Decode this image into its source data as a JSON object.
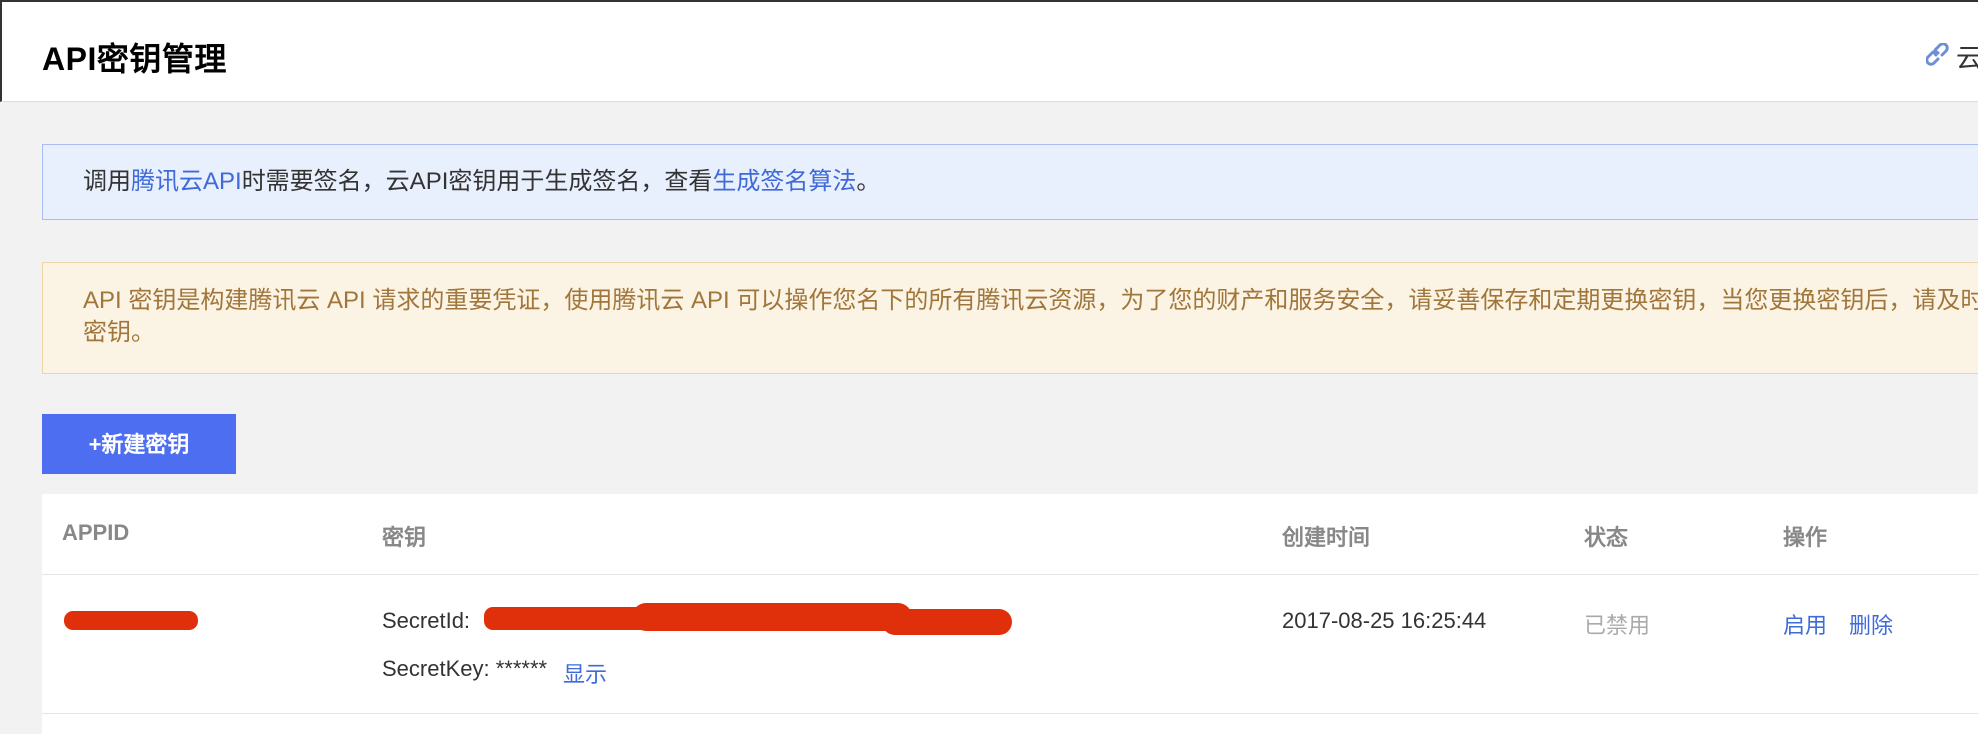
{
  "header": {
    "title": "API密钥管理",
    "right_link_text": "云"
  },
  "info": {
    "prefix": "调用",
    "link1": "腾讯云API",
    "middle": "时需要签名，云API密钥用于生成签名，查看",
    "link2": "生成签名算法",
    "suffix": "。"
  },
  "warning": {
    "line1": "API 密钥是构建腾讯云 API 请求的重要凭证，使用腾讯云 API 可以操作您名下的所有腾讯云资源，为了您的财产和服务安全，请妥善保存和定期更换密钥，当您更换密钥后，请及时",
    "line2": "密钥。"
  },
  "toolbar": {
    "new_key_label": "+新建密钥"
  },
  "table": {
    "headers": {
      "appid": "APPID",
      "key": "密钥",
      "created": "创建时间",
      "status": "状态",
      "actions": "操作"
    },
    "rows": [
      {
        "secret_id_label": "SecretId:",
        "secret_key_label": "SecretKey: ******",
        "show_label": "显示",
        "created": "2017-08-25 16:25:44",
        "status": "已禁用",
        "enable_label": "启用",
        "delete_label": "删除"
      }
    ]
  },
  "colors": {
    "accent": "#4e6ef2",
    "link": "#3f6ad8",
    "info_bg": "#e8effd",
    "warning_bg": "#fbf3e4",
    "warning_text": "#a1763a",
    "redaction": "#e0300b"
  },
  "icons": {
    "header_link": "link-icon"
  }
}
